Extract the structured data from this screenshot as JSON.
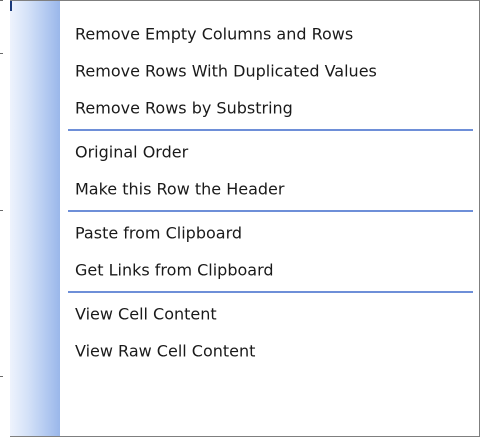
{
  "menu": {
    "groups": [
      {
        "items": [
          {
            "label": "Remove Empty Columns and Rows"
          },
          {
            "label": "Remove Rows With Duplicated Values"
          },
          {
            "label": "Remove Rows by Substring"
          }
        ]
      },
      {
        "items": [
          {
            "label": "Original Order"
          },
          {
            "label": "Make this Row the Header"
          }
        ]
      },
      {
        "items": [
          {
            "label": "Paste from Clipboard"
          },
          {
            "label": "Get Links from Clipboard"
          }
        ]
      },
      {
        "items": [
          {
            "label": "View Cell Content"
          },
          {
            "label": "View Raw Cell Content"
          }
        ]
      }
    ]
  },
  "colors": {
    "separator": "#6e8fd8",
    "gutter_dark": "#9ab7ea",
    "gutter_light": "#eef3fd",
    "text": "#1a1a1a"
  }
}
